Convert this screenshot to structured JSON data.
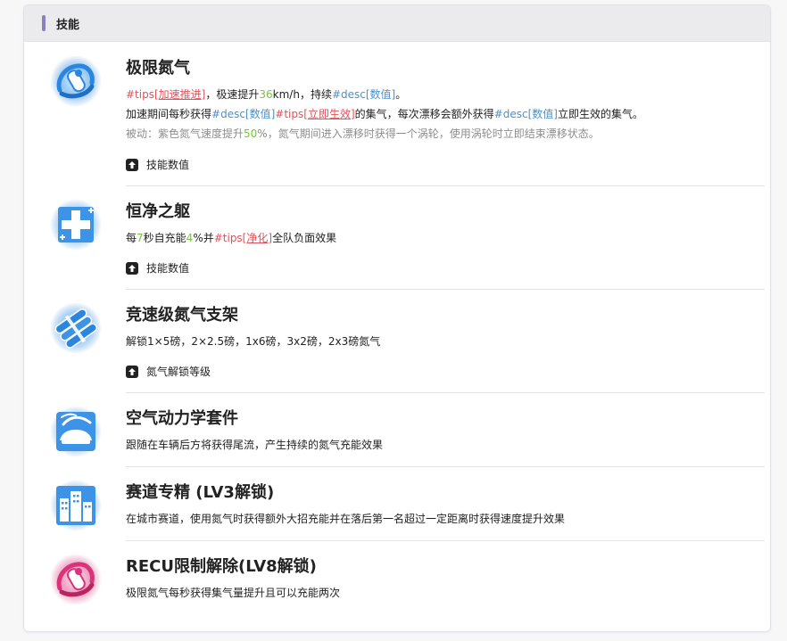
{
  "header": {
    "title": "技能"
  },
  "skills": [
    {
      "name": "极限氮气",
      "icon": "nitro-extreme-icon",
      "line1": {
        "tips": "#tips[",
        "link": "加速推进",
        "close": "]",
        "t1": "，极速提升",
        "num": "36",
        "t2": "km/h，持续",
        "desc": "#desc",
        "descval": "[数值]",
        "end": "。"
      },
      "line2": {
        "t1": "加速期间每秒获得",
        "desc1": "#desc",
        "descval1": "[数值]",
        "tips": "#tips[",
        "link": "立即生效",
        "close": "]",
        "t2": "的集气，每次漂移会额外获得",
        "desc2": "#desc",
        "descval2": "[数值]",
        "t3": "立即生效的集气。"
      },
      "passive": {
        "t1": "被动：紫色氮气速度提升",
        "num": "50",
        "t2": "%，氮气期间进入漂移时获得一个涡轮，使用涡轮时立即结束漂移状态。"
      },
      "expand": "技能数值"
    },
    {
      "name": "恒净之躯",
      "icon": "medical-cross-icon",
      "line1": {
        "t1": "每",
        "num1": "7",
        "t2": "秒自充能",
        "num2": "4",
        "t3": "%并",
        "tips": "#tips[",
        "link": "净化",
        "close": "]",
        "t4": "全队负面效果"
      },
      "expand": "技能数值"
    },
    {
      "name": "竞速级氮气支架",
      "icon": "nitro-tanks-icon",
      "desc": "解锁1×5磅，2×2.5磅，1x6磅，3x2磅，2x3磅氮气",
      "expand": "氮气解锁等级"
    },
    {
      "name": "空气动力学套件",
      "icon": "aero-car-icon",
      "desc": "跟随在车辆后方将获得尾流，产生持续的氮气充能效果"
    },
    {
      "name": "赛道专精 (LV3解锁)",
      "icon": "city-buildings-icon",
      "desc": "在城市赛道，使用氮气时获得额外大招充能并在落后第一名超过一定距离时获得速度提升效果"
    },
    {
      "name": "RECU限制解除(LV8解锁)",
      "icon": "nitro-extreme-pink-icon",
      "desc": "极限氮气每秒获得集气量提升且可以充能两次"
    }
  ],
  "colors": {
    "icon_blue": "#2b86e0",
    "icon_pink": "#d9337a",
    "tips_red": "#e0535b",
    "desc_blue": "#4f8fc8",
    "num_green": "#7cc244",
    "accent_bar": "#8b7fc0"
  }
}
